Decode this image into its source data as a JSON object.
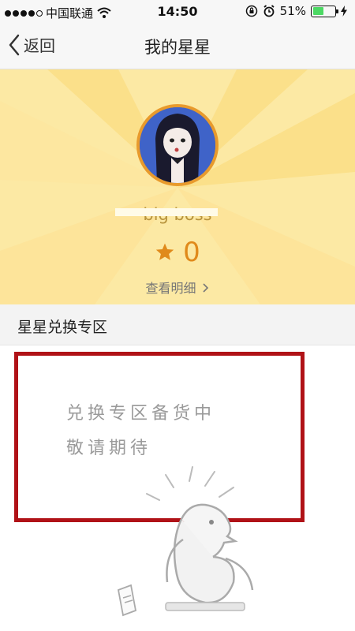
{
  "status_bar": {
    "carrier": "中国联通",
    "time": "14:50",
    "battery": "51%",
    "battery_level": 0.51
  },
  "nav": {
    "back_label": "返回",
    "title": "我的星星"
  },
  "profile": {
    "username": "big boss",
    "star_count": "0",
    "detail_link": "查看明细"
  },
  "section": {
    "title": "星星兑换专区"
  },
  "empty_state": {
    "line1": "兑换专区备货中",
    "line2": "敬请期待"
  },
  "colors": {
    "header_bg": "#fce9a4",
    "accent": "#e08a1b",
    "highlight_border": "#b01217",
    "battery": "#4cd964"
  }
}
